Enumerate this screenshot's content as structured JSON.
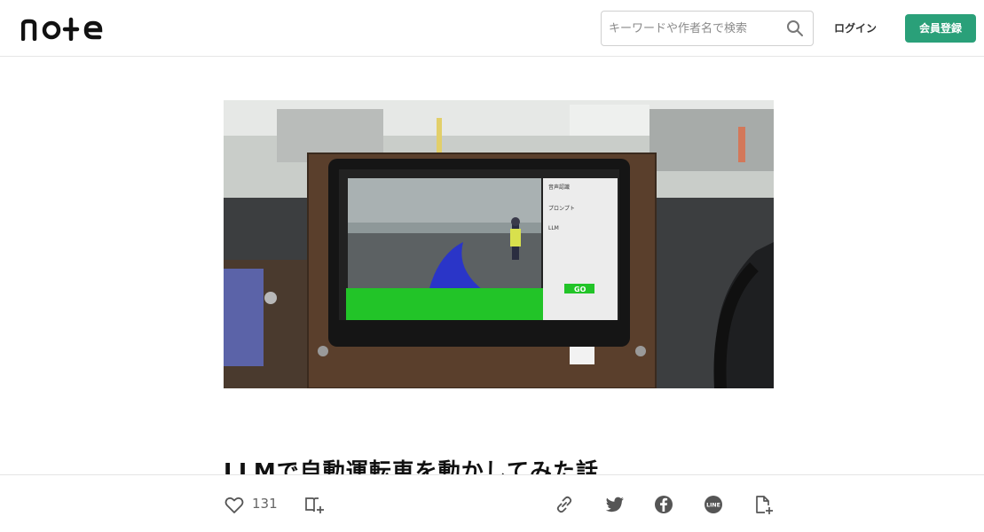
{
  "header": {
    "logo_text": "note",
    "search_placeholder": "キーワードや作者名で検索",
    "login_label": "ログイン",
    "signup_label": "会員登録",
    "signup_color": "#2aa079"
  },
  "article": {
    "title": "LLMで自動運転車を動かしてみた話",
    "hero_screen": {
      "panel_heading_1": "音声認識",
      "panel_heading_2": "プロンプト",
      "panel_heading_3": "LLM",
      "status_button": "GO"
    }
  },
  "footer": {
    "like_count": "131",
    "icons": [
      "heart-icon",
      "magazine-add-icon",
      "link-icon",
      "twitter-icon",
      "facebook-icon",
      "line-icon",
      "note-add-icon"
    ]
  }
}
